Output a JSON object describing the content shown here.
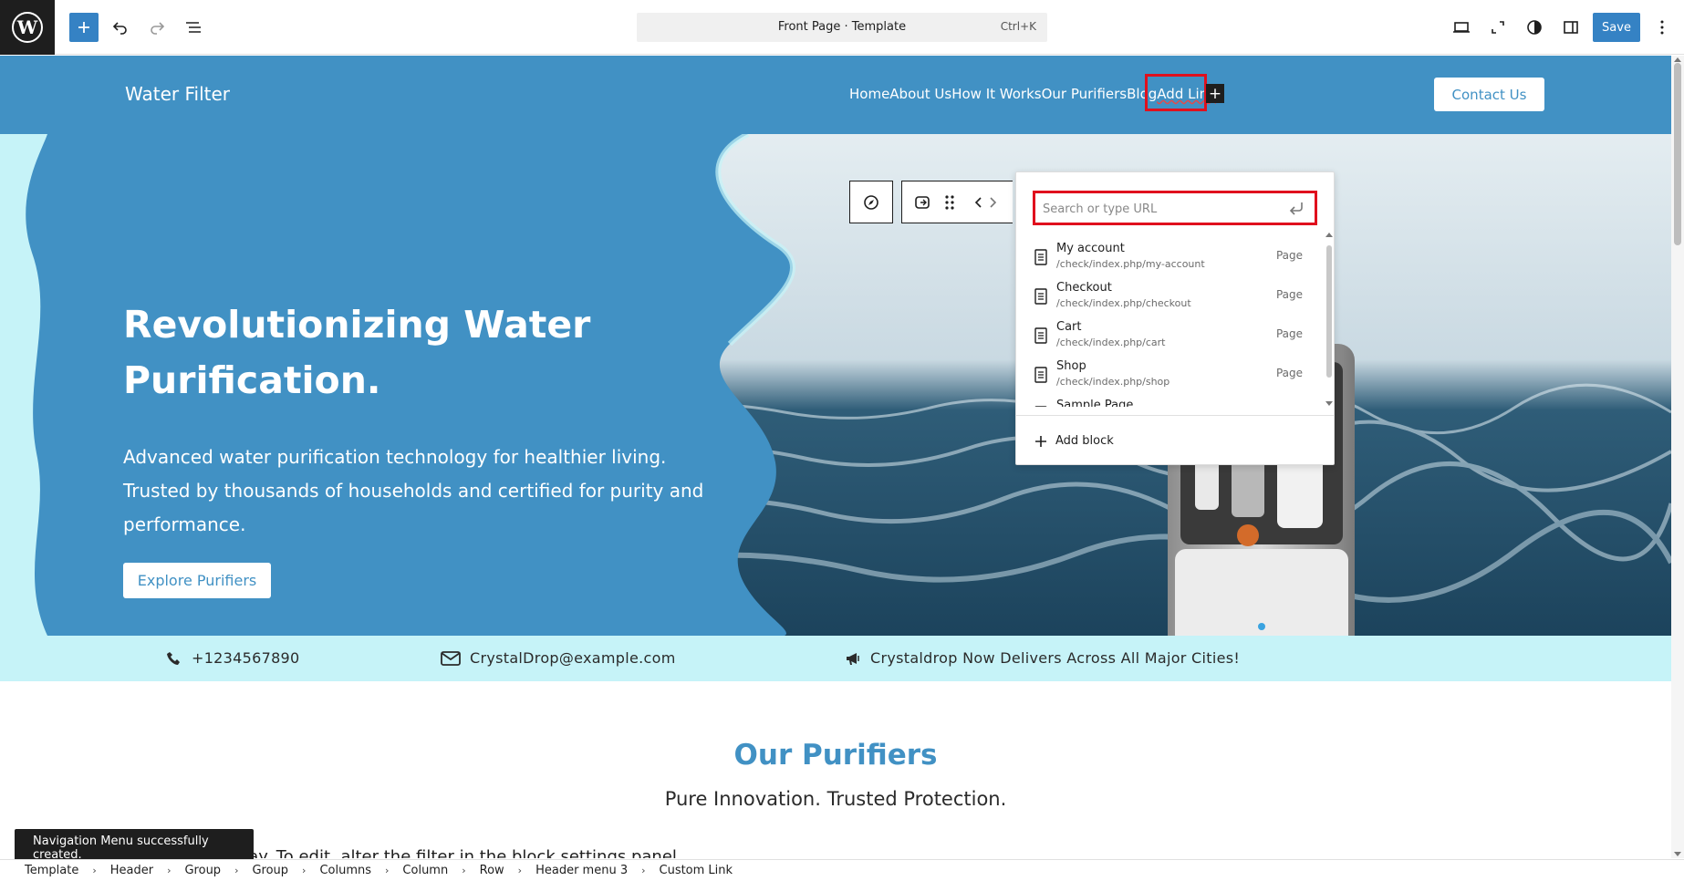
{
  "topbar": {
    "title": "Front Page · Template",
    "shortcut": "Ctrl+K",
    "save_label": "Save"
  },
  "site": {
    "title": "Water Filter",
    "nav": [
      "Home",
      "About Us",
      "How It Works",
      "Our Purifiers",
      "Blog",
      "Add Link"
    ],
    "contact_label": "Contact Us"
  },
  "hero": {
    "title": "Revolutionizing Water Purification.",
    "subtitle": "Advanced water purification technology for healthier living. Trusted by thousands of households and certified for purity and performance.",
    "button_label": "Explore Purifiers"
  },
  "info": {
    "phone": "+1234567890",
    "email": "CrystalDrop@example.com",
    "announcement": "Crystaldrop Now Delivers Across All Major Cities!"
  },
  "section": {
    "title": "Our Purifiers",
    "subtitle": "Pure Innovation. Trusted Protection.",
    "cut_text": "display. To edit, alter the filter in the block settings panel."
  },
  "link_popover": {
    "placeholder": "Search or type URL",
    "suggestions": [
      {
        "title": "My account",
        "url": "/check/index.php/my-account",
        "type": "Page"
      },
      {
        "title": "Checkout",
        "url": "/check/index.php/checkout",
        "type": "Page"
      },
      {
        "title": "Cart",
        "url": "/check/index.php/cart",
        "type": "Page"
      },
      {
        "title": "Shop",
        "url": "/check/index.php/shop",
        "type": "Page"
      },
      {
        "title": "Sample Page",
        "url": "",
        "type": "Page"
      }
    ],
    "add_block_label": "Add block"
  },
  "snackbar": {
    "message": "Navigation Menu successfully created."
  },
  "breadcrumb": [
    "Template",
    "Header",
    "Group",
    "Group",
    "Columns",
    "Column",
    "Row",
    "Header menu 3",
    "Custom Link"
  ],
  "colors": {
    "accent": "#3582c4",
    "header_blue": "#4191c4",
    "light_cyan": "#c6f3f8",
    "highlight_red": "#e0101d"
  }
}
